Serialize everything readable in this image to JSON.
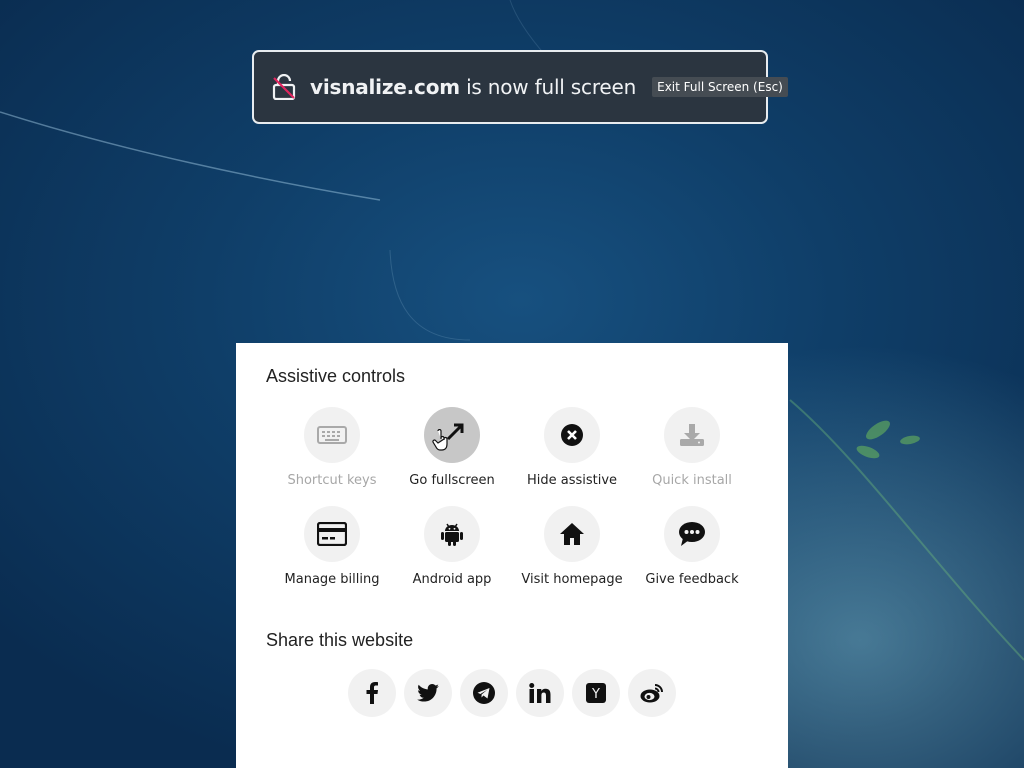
{
  "fullscreen_notice": {
    "domain": "visnalize.com",
    "message": "is now full screen",
    "exit_label": "Exit Full Screen (Esc)"
  },
  "assistive": {
    "title": "Assistive controls",
    "controls": [
      {
        "label": "Shortcut keys",
        "icon": "keyboard-icon",
        "enabled": false
      },
      {
        "label": "Go fullscreen",
        "icon": "expand-arrow-icon",
        "enabled": true,
        "active": true
      },
      {
        "label": "Hide assistive",
        "icon": "close-circle-icon",
        "enabled": true
      },
      {
        "label": "Quick install",
        "icon": "download-icon",
        "enabled": false
      },
      {
        "label": "Manage billing",
        "icon": "credit-card-icon",
        "enabled": true
      },
      {
        "label": "Android app",
        "icon": "android-icon",
        "enabled": true
      },
      {
        "label": "Visit homepage",
        "icon": "home-icon",
        "enabled": true
      },
      {
        "label": "Give feedback",
        "icon": "chat-bubble-icon",
        "enabled": true
      }
    ]
  },
  "share": {
    "title": "Share this website",
    "buttons": [
      {
        "icon": "facebook-icon"
      },
      {
        "icon": "twitter-icon"
      },
      {
        "icon": "telegram-icon"
      },
      {
        "icon": "linkedin-icon"
      },
      {
        "icon": "hacker-news-icon",
        "glyph": "Y"
      },
      {
        "icon": "weibo-icon"
      }
    ]
  },
  "colors": {
    "notice_bg": "#2b3540",
    "panel_bg": "#ffffff",
    "button_bg": "#f1f1f1",
    "active_button_bg": "#c7c7c7",
    "disabled_text": "#a7a7a7"
  }
}
